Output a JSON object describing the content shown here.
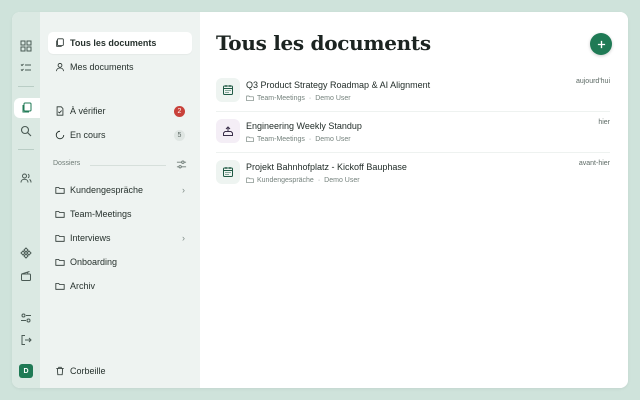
{
  "sidebar": {
    "nav": {
      "all_docs": "Tous les documents",
      "my_docs": "Mes documents",
      "to_review": "À vérifier",
      "to_review_count": "2",
      "in_progress": "En cours",
      "in_progress_count": "5"
    },
    "folders_label": "Dossiers",
    "folders": [
      "Kundengespräche",
      "Team-Meetings",
      "Interviews",
      "Onboarding",
      "Archiv"
    ],
    "trash": "Corbeille"
  },
  "user": {
    "initial": "D"
  },
  "main": {
    "title": "Tous les documents",
    "documents": [
      {
        "title": "Q3 Product Strategy Roadmap & AI Alignment",
        "folder": "Team-Meetings",
        "author": "Demo User",
        "date": "aujourd'hui",
        "icon": "calendar-icon"
      },
      {
        "title": "Engineering Weekly Standup",
        "folder": "Team-Meetings",
        "author": "Demo User",
        "date": "hier",
        "icon": "upload-tray-icon"
      },
      {
        "title": "Projekt Bahnhofplatz - Kickoff Bauphase",
        "folder": "Kundengespräche",
        "author": "Demo User",
        "date": "avant-hier",
        "icon": "calendar-icon"
      }
    ]
  },
  "colors": {
    "accent": "#1f7a55",
    "badge_red": "#c8413a",
    "background": "#cfe3db"
  }
}
